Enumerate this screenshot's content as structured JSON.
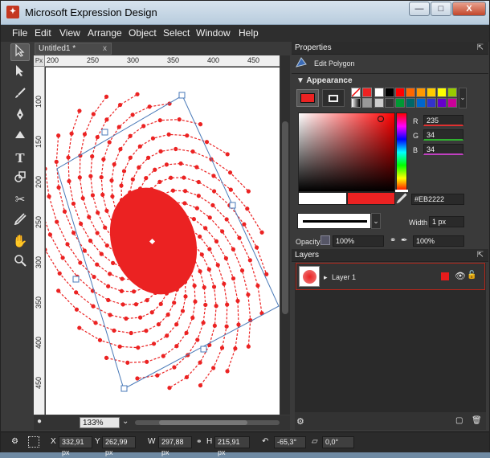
{
  "app": {
    "title": "Microsoft Expression Design",
    "icon": "expression-design-icon"
  },
  "window_buttons": {
    "minimize": "—",
    "maximize": "□",
    "close": "X"
  },
  "menu": [
    "File",
    "Edit",
    "View",
    "Arrange",
    "Object",
    "Select",
    "Window",
    "Help"
  ],
  "tools": [
    "selection-arrow-icon",
    "direct-select-icon",
    "brush-icon",
    "pen-icon",
    "fill-icon",
    "text-icon",
    "shape-icon",
    "scissors-icon",
    "eyedropper-icon",
    "hand-icon",
    "zoom-icon"
  ],
  "document": {
    "tab_label": "Untitled1 *",
    "tab_close": "x",
    "ruler_unit": "Px",
    "ruler_h_ticks": [
      "200",
      "250",
      "300",
      "350",
      "400",
      "450"
    ],
    "ruler_v_ticks": [
      "100",
      "150",
      "200",
      "250",
      "300",
      "350",
      "400",
      "450"
    ],
    "zoom": "133%"
  },
  "properties": {
    "header": "Properties",
    "context_label": "Edit Polygon",
    "appearance_header": "Appearance",
    "color": {
      "r_label": "R",
      "r_value": "235",
      "g_label": "G",
      "g_value": "34",
      "b_label": "B",
      "b_value": "34",
      "hex": "#EB2222"
    },
    "width_label": "Width",
    "width_value": "1 px",
    "opacity_label": "Opacity",
    "opacity_value": "100%",
    "opacity2_value": "100%",
    "swatches": [
      "#ffffff",
      "#000000",
      "#ff0000",
      "#ff6600",
      "#ff9900",
      "#ffcc00",
      "#ffff00",
      "#99cc00",
      "#cccccc",
      "#333333",
      "#009933",
      "#006666",
      "#0066cc",
      "#3333cc",
      "#6600cc",
      "#cc0099"
    ]
  },
  "layers": {
    "header": "Layers",
    "items": [
      {
        "name": "Layer 1",
        "color": "#e61b1b"
      }
    ]
  },
  "status": {
    "x_label": "X",
    "x_value": "332,91 px",
    "y_label": "Y",
    "y_value": "262,99 px",
    "w_label": "W",
    "w_value": "297,88 px",
    "h_label": "H",
    "h_value": "215,91 px",
    "rotation_value": "-65,3°",
    "skew_value": "0,0°"
  },
  "colors": {
    "accent": "#eb2222",
    "selection": "#4a7ab8"
  }
}
